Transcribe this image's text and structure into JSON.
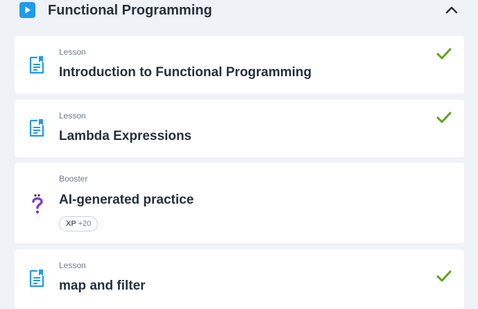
{
  "section": {
    "title": "Functional Programming",
    "play_icon": "play-icon",
    "collapse_icon": "chevron-up-icon",
    "accent": "#1e9bec"
  },
  "items": [
    {
      "type": "Lesson",
      "title": "Introduction to Functional Programming",
      "icon": "lesson-document-icon",
      "completed": true
    },
    {
      "type": "Lesson",
      "title": "Lambda Expressions",
      "icon": "lesson-document-icon",
      "completed": true
    },
    {
      "type": "Booster",
      "title": "AI-generated practice",
      "icon": "question-mark-icon",
      "completed": false,
      "xp": {
        "label": "XP",
        "value": "+20"
      }
    },
    {
      "type": "Lesson",
      "title": "map and filter",
      "icon": "lesson-document-icon",
      "completed": true
    }
  ],
  "colors": {
    "check": "#5aa51a",
    "booster": "#7b3fc4",
    "icon": "#1e9bec"
  }
}
